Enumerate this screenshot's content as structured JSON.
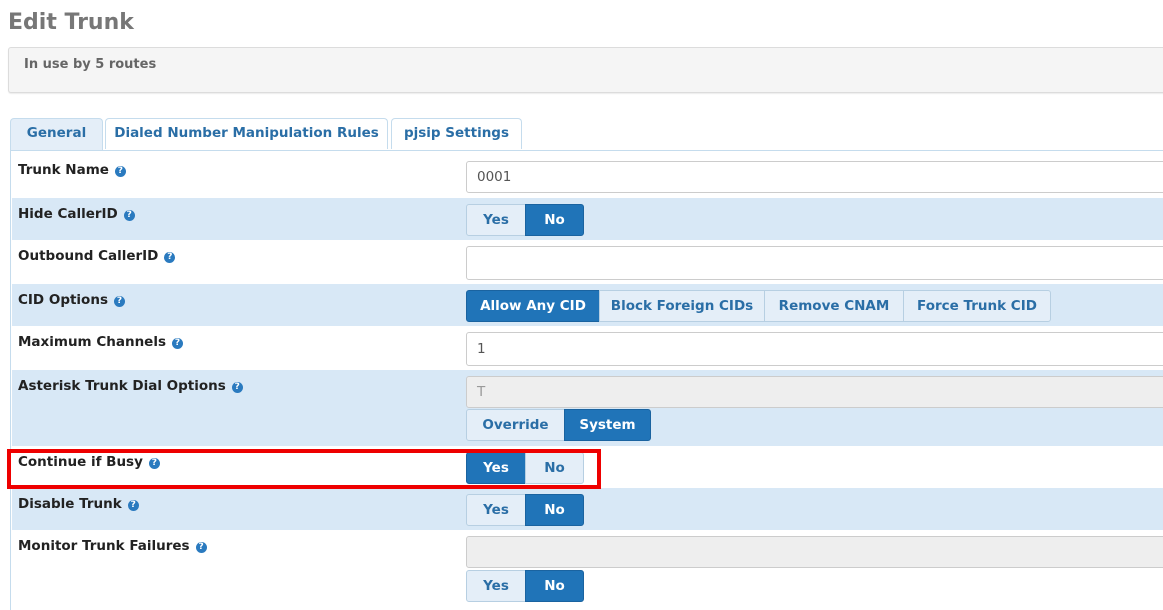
{
  "page": {
    "title": "Edit Trunk",
    "info": "In use by 5 routes"
  },
  "tabs": [
    {
      "label": "General",
      "active": true
    },
    {
      "label": "Dialed Number Manipulation Rules",
      "active": false
    },
    {
      "label": "pjsip Settings",
      "active": false
    }
  ],
  "form": {
    "trunk_name": {
      "label": "Trunk Name",
      "value": "0001"
    },
    "hide_callerid": {
      "label": "Hide CallerID",
      "options": [
        "Yes",
        "No"
      ],
      "selected": "No"
    },
    "outbound_callerid": {
      "label": "Outbound CallerID",
      "value": ""
    },
    "cid_options": {
      "label": "CID Options",
      "options": [
        "Allow Any CID",
        "Block Foreign CIDs",
        "Remove CNAM",
        "Force Trunk CID"
      ],
      "selected": "Allow Any CID"
    },
    "max_channels": {
      "label": "Maximum Channels",
      "value": "1"
    },
    "dial_options": {
      "label": "Asterisk Trunk Dial Options",
      "value": "T",
      "options": [
        "Override",
        "System"
      ],
      "selected": "System"
    },
    "continue_if_busy": {
      "label": "Continue if Busy",
      "options": [
        "Yes",
        "No"
      ],
      "selected": "Yes"
    },
    "disable_trunk": {
      "label": "Disable Trunk",
      "options": [
        "Yes",
        "No"
      ],
      "selected": "No"
    },
    "monitor_failures": {
      "label": "Monitor Trunk Failures",
      "value": "",
      "options": [
        "Yes",
        "No"
      ],
      "selected": "No"
    }
  },
  "help_glyph": "?",
  "colors": {
    "accent": "#2074b8",
    "highlight": "#ee0000",
    "row_alt": "#d8e8f6"
  }
}
